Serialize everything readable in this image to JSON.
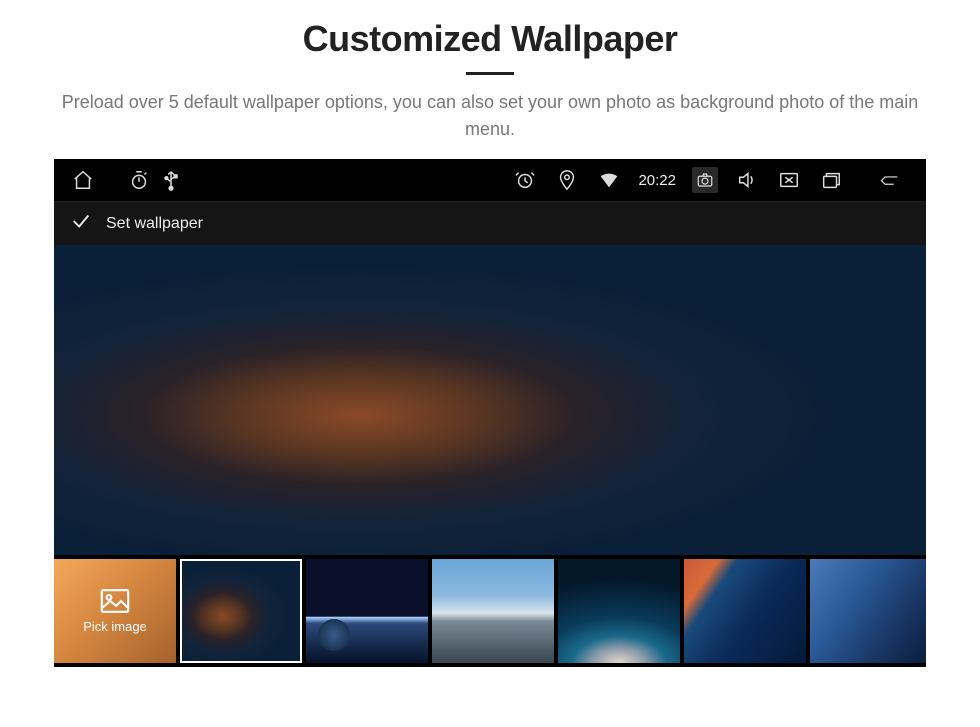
{
  "header": {
    "title": "Customized Wallpaper",
    "subtitle": "Preload over 5 default wallpaper options, you can also set your own photo as background photo of the main menu."
  },
  "statusbar": {
    "clock": "20:22"
  },
  "titlebar": {
    "label": "Set wallpaper"
  },
  "thumbs": {
    "pick_label": "Pick image"
  }
}
